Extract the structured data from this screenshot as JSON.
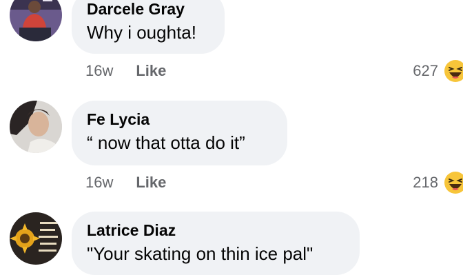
{
  "comments": [
    {
      "author": "Darcele Gray",
      "text": "Why i oughta!",
      "time": "16w",
      "like_label": "Like",
      "reaction_count": "627",
      "reaction_icon": "haha-emoji-icon"
    },
    {
      "author": "Fe Lycia",
      "text": "“ now that otta do it”",
      "time": "16w",
      "like_label": "Like",
      "reaction_count": "218",
      "reaction_icon": "haha-emoji-icon"
    },
    {
      "author": "Latrice Diaz",
      "text": "\"Your skating on thin ice pal\""
    }
  ],
  "colors": {
    "bubble": "#f0f2f5",
    "secondary_text": "#65676b",
    "primary_text": "#050505",
    "haha_yellow": "#f7c53a"
  }
}
